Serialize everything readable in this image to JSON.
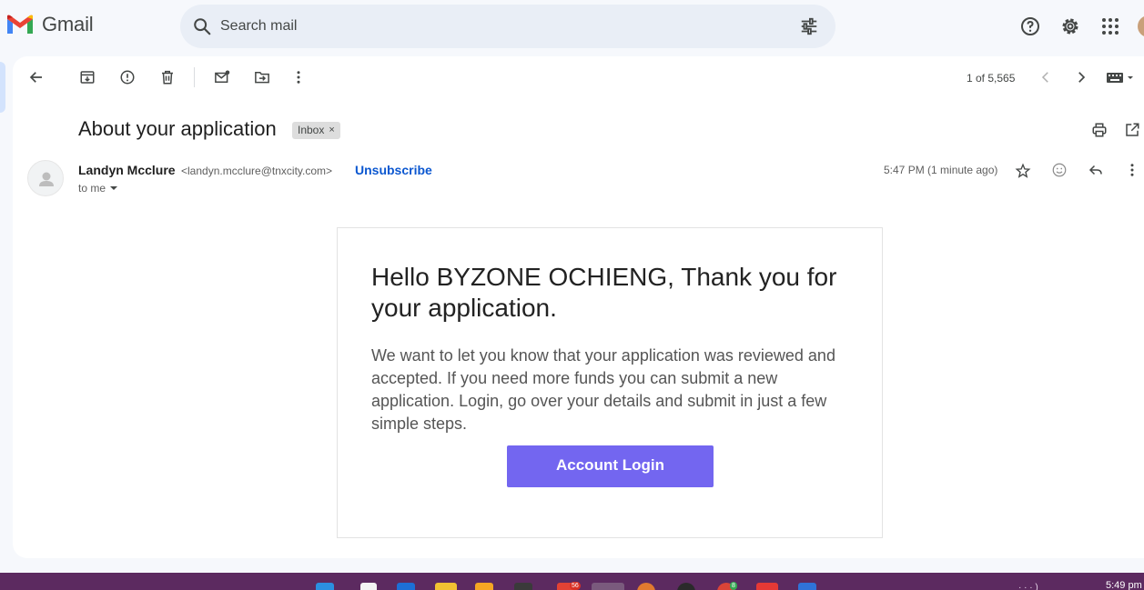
{
  "app": {
    "title": "Gmail"
  },
  "search": {
    "placeholder": "Search mail"
  },
  "header_icons": [
    "help-icon",
    "settings-icon",
    "apps-icon"
  ],
  "toolbar": {
    "icons": [
      "back-icon",
      "archive-icon",
      "report-spam-icon",
      "delete-icon",
      "mark-unread-icon",
      "move-to-icon",
      "more-icon"
    ],
    "pager": "1 of 5,565"
  },
  "message": {
    "subject": "About your application",
    "label": "Inbox",
    "label_close": "×",
    "sender_name": "Landyn Mcclure",
    "sender_email": "<landyn.mcclure@tnxcity.com>",
    "unsubscribe": "Unsubscribe",
    "recipient": "to me",
    "time": "5:47 PM (1 minute ago)"
  },
  "body": {
    "heading": "Hello BYZONE OCHIENG, Thank you for your application.",
    "paragraph": "We want to let you know that your application was reviewed and accepted. If you need more funds you can submit a new application. Login, go over your details and submit in just a few simple steps.",
    "button": "Account Login"
  },
  "taskbar": {
    "time": "5:49 pm",
    "badges": [
      "56",
      "8"
    ]
  },
  "colors": {
    "accent": "#0b57d0",
    "button": "#7366f0",
    "taskbar": "#5c2a60"
  }
}
